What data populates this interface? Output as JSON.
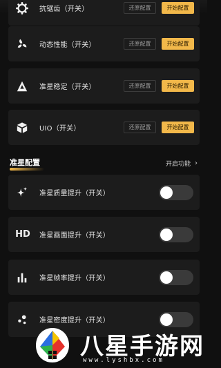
{
  "features_top": [
    {
      "label": "抗锯齿（开关）",
      "icon": "gear-icon",
      "restore": "还原配置",
      "start": "开始配置"
    },
    {
      "label": "动态性能（开关）",
      "icon": "fan-icon",
      "restore": "还原配置",
      "start": "开始配置"
    },
    {
      "label": "准星稳定（开关）",
      "icon": "mountain-icon",
      "restore": "还原配置",
      "start": "开始配置"
    },
    {
      "label": "UIO（开关）",
      "icon": "cube-icon",
      "restore": "还原配置",
      "start": "开始配置"
    }
  ],
  "section": {
    "title": "准星配置",
    "link": "开启功能",
    "chevron": "›"
  },
  "features_bottom": [
    {
      "label": "准星质量提升（开关）",
      "icon": "sparkle-icon",
      "on": false
    },
    {
      "label": "准星画面提升（开关）",
      "icon": "hd-icon",
      "icon_text": "HD",
      "on": false
    },
    {
      "label": "准星帧率提升（开关）",
      "icon": "bars-icon",
      "on": false
    },
    {
      "label": "准星密度提升（开关）",
      "icon": "dots-icon",
      "on": false
    }
  ],
  "watermark": {
    "name": "八星手游网",
    "url": "www.lyshbx.com"
  },
  "colors": {
    "background": "#101010",
    "card": "#1c1c1c",
    "accent": "#f2b84a",
    "toggle_off": "#3a3a3a"
  }
}
